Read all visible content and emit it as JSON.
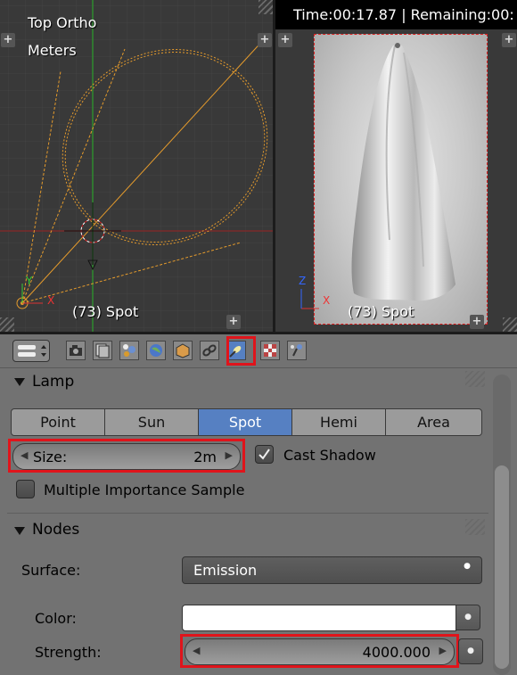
{
  "viewport_left": {
    "view_name": "Top Ortho",
    "units": "Meters",
    "object_label": "(73) Spot",
    "axis_x_label": "X",
    "axis_y_label": "Y"
  },
  "viewport_right": {
    "render_status": "Time:00:17.87 | Remaining:00:",
    "object_label": "(73) Spot",
    "axis_x_label": "X",
    "axis_z_label": "Z"
  },
  "properties_tabs": [
    {
      "name": "render-tab-icon",
      "active": false
    },
    {
      "name": "render-layers-tab-icon",
      "active": false
    },
    {
      "name": "scene-tab-icon",
      "active": false
    },
    {
      "name": "world-tab-icon",
      "active": false
    },
    {
      "name": "object-tab-icon",
      "active": false
    },
    {
      "name": "constraints-tab-icon",
      "active": false
    },
    {
      "name": "lamp-data-tab-icon",
      "active": true
    },
    {
      "name": "texture-tab-icon",
      "active": false
    },
    {
      "name": "particles-tab-icon",
      "active": false
    }
  ],
  "lamp_panel": {
    "title": "Lamp",
    "types": [
      "Point",
      "Sun",
      "Spot",
      "Hemi",
      "Area"
    ],
    "selected_type": "Spot",
    "size_label": "Size:",
    "size_value": "2m",
    "cast_shadow_label": "Cast Shadow",
    "cast_shadow_checked": true,
    "mis_label": "Multiple Importance Sample",
    "mis_checked": false
  },
  "nodes_panel": {
    "title": "Nodes",
    "surface_label": "Surface:",
    "surface_value": "Emission",
    "color_label": "Color:",
    "color_value": "#ffffff",
    "strength_label": "Strength:",
    "strength_value": "4000.000"
  },
  "colors": {
    "accent_blue": "#5680c2",
    "highlight_red": "#e0141b",
    "viewport_bg": "#393939",
    "panel_bg": "#727272"
  }
}
